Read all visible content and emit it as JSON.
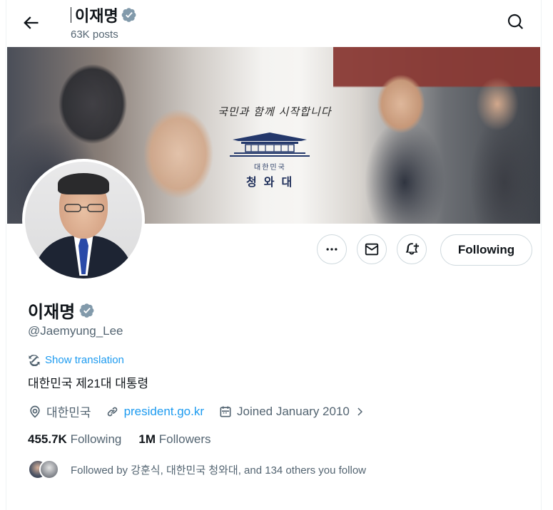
{
  "header": {
    "name": "이재명",
    "posts": "63K posts"
  },
  "banner": {
    "slogan": "국민과 함께 시작합니다",
    "logo_small": "대한민국",
    "logo_big": "청와대"
  },
  "actions": {
    "following_label": "Following"
  },
  "profile": {
    "name": "이재명",
    "handle": "@Jaemyung_Lee",
    "show_translation": "Show translation",
    "bio": "대한민국 제21대 대통령",
    "location": "대한민국",
    "website": "president.go.kr",
    "joined": "Joined January 2010",
    "following_count": "455.7K",
    "following_label": "Following",
    "followers_count": "1M",
    "followers_label": "Followers",
    "followed_by": "Followed by 강훈식, 대한민국 청와대, and 134 others you follow"
  },
  "icons": {
    "verified": "verified-badge-icon",
    "back": "arrow-left-icon",
    "search": "search-icon",
    "more": "more-icon",
    "message": "mail-icon",
    "notify": "bell-add-icon",
    "translate": "translate-icon",
    "location": "location-pin-icon",
    "link": "link-icon",
    "calendar": "calendar-icon",
    "chevron": "chevron-right-icon"
  },
  "colors": {
    "accent": "#1d9bf0",
    "verified": "#829aab",
    "muted_text": "#536471",
    "border": "#cfd9de"
  }
}
